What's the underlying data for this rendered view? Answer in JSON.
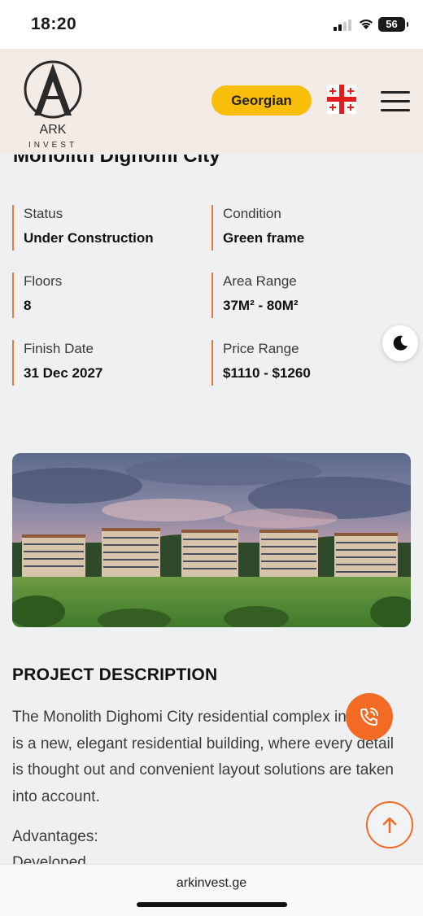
{
  "status_bar": {
    "time": "18:20",
    "battery": "56"
  },
  "header": {
    "logo_letter": "A",
    "logo_name": "ARK",
    "logo_sub": "INVEST",
    "language_button": "Georgian",
    "flag_icon": "georgia-flag-icon",
    "menu_icon": "hamburger-menu-icon"
  },
  "project": {
    "title": "Monolith Dighomi City",
    "specs": [
      {
        "label": "Status",
        "value": "Under Construction"
      },
      {
        "label": "Condition",
        "value": "Green frame"
      },
      {
        "label": "Floors",
        "value": "8"
      },
      {
        "label": "Area Range",
        "value": "37M² - 80M²"
      },
      {
        "label": "Finish Date",
        "value": "31 Dec 2027"
      },
      {
        "label": "Price Range",
        "value": "$1110 - $1260"
      }
    ]
  },
  "description": {
    "heading": "PROJECT DESCRIPTION",
    "text": "The Monolith Dighomi City residential complex in Tbilisi is a new, elegant residential building, where every detail is thought out and convenient layout solutions are taken into account.",
    "advantages_label": "Advantages:",
    "advantages_first": "Developed ..."
  },
  "floating": {
    "dark_mode_icon": "moon-icon",
    "call_icon": "phone-icon",
    "scroll_top_icon": "arrow-up-icon"
  },
  "browser": {
    "url": "arkinvest.ge"
  },
  "colors": {
    "accent": "#f26a24",
    "language_button": "#f8be0a",
    "header_bg": "#f3ebe6",
    "page_bg": "#eef0f2"
  }
}
